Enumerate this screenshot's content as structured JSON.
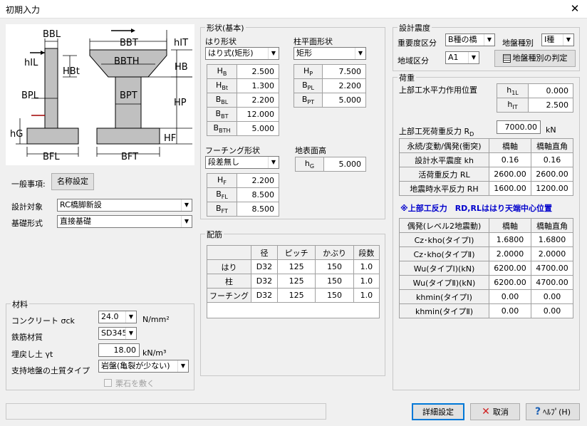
{
  "window": {
    "title": "初期入力",
    "close": "✕"
  },
  "diagram": {
    "labels": {
      "bbl": "BBL",
      "bbt": "BBT",
      "hit": "hIT",
      "hil": "hIL",
      "hbt": "HBt",
      "bbth": "BBTH",
      "hb": "HB",
      "hp": "HP",
      "bpl": "BPL",
      "bpt": "BPT",
      "hg": "hG",
      "hf": "HF",
      "bfl": "BFL",
      "bft": "BFT"
    }
  },
  "general": {
    "label": "一般事項:",
    "name_button": "名称設定"
  },
  "design_target": {
    "label": "設計対象",
    "value": "RC橋脚新設"
  },
  "foundation": {
    "label": "基礎形式",
    "value": "直接基礎"
  },
  "material": {
    "title": "材料",
    "concrete_label": "コンクリート σck",
    "concrete_value": "24.0",
    "concrete_unit": "N/mm²",
    "rebar_label": "鉄筋材質",
    "rebar_value": "SD345",
    "backfill_label": "埋戻し土 γt",
    "backfill_value": "18.00",
    "backfill_unit": "kN/m³",
    "soil_label": "支持地盤の土質タイプ",
    "soil_value": "岩盤(亀裂が少ない)",
    "gravel_label": "栗石を敷く"
  },
  "shape": {
    "title": "形状(基本)",
    "beam_label": "はり形状",
    "beam_value": "はり式(矩形)",
    "beam_rows": [
      {
        "name": "H",
        "sub": "B",
        "value": "2.500"
      },
      {
        "name": "H",
        "sub": "Bt",
        "value": "1.300"
      },
      {
        "name": "B",
        "sub": "BL",
        "value": "2.200"
      },
      {
        "name": "B",
        "sub": "BT",
        "value": "12.000"
      },
      {
        "name": "B",
        "sub": "BTH",
        "value": "5.000"
      }
    ],
    "column_label": "柱平面形状",
    "column_value": "矩形",
    "column_rows": [
      {
        "name": "H",
        "sub": "P",
        "value": "7.500"
      },
      {
        "name": "B",
        "sub": "PL",
        "value": "2.200"
      },
      {
        "name": "B",
        "sub": "PT",
        "value": "5.000"
      }
    ],
    "footing_label": "フーチング形状",
    "footing_value": "段差無し",
    "footing_rows": [
      {
        "name": "H",
        "sub": "F",
        "value": "2.200"
      },
      {
        "name": "B",
        "sub": "FL",
        "value": "8.500"
      },
      {
        "name": "B",
        "sub": "FT",
        "value": "8.500"
      }
    ],
    "ground_label": "地表面高",
    "ground_row": {
      "name": "h",
      "sub": "G",
      "value": "5.000"
    }
  },
  "rebar": {
    "title": "配筋",
    "headers": [
      "",
      "径",
      "ピッチ",
      "かぶり",
      "段数"
    ],
    "rows": [
      [
        "はり",
        "D32",
        "125",
        "150",
        "1.0"
      ],
      [
        "柱",
        "D32",
        "125",
        "150",
        "1.0"
      ],
      [
        "フーチング",
        "D32",
        "125",
        "150",
        "1.0"
      ]
    ]
  },
  "seismic": {
    "title": "設計震度",
    "importance_label": "重要度区分",
    "importance_value": "B種の橋",
    "ground_type_label": "地盤種別",
    "ground_type_value": "I種",
    "region_label": "地域区分",
    "region_value": "A1",
    "judge_button": "地盤種別の判定"
  },
  "load": {
    "title": "荷重",
    "hpos_label": "上部工水平力作用位置",
    "hpos_rows": [
      {
        "name": "h",
        "sub": "1L",
        "value": "0.000"
      },
      {
        "name": "h",
        "sub": "IT",
        "value": "2.500"
      }
    ],
    "rd_label": "上部工死荷重反力 R",
    "rd_sub": "D",
    "rd_value": "7000.00",
    "rd_unit": "kN",
    "perm_headers": [
      "永続/変動/偶発(衝突)",
      "橋軸",
      "橋軸直角"
    ],
    "perm_rows": [
      [
        "設計水平震度 kh",
        "0.16",
        "0.16"
      ],
      [
        "活荷重反力 RL",
        "2600.00",
        "2600.00"
      ],
      [
        "地震時水平反力 RH",
        "1600.00",
        "1200.00"
      ]
    ],
    "note": "※上部工反力　RD,RLははり天端中心位置",
    "acc_headers": [
      "偶発(レベル2地震動)",
      "橋軸",
      "橋軸直角"
    ],
    "acc_rows": [
      [
        "Cz･kho(タイプⅠ)",
        "1.6800",
        "1.6800"
      ],
      [
        "Cz･kho(タイプⅡ)",
        "2.0000",
        "2.0000"
      ],
      [
        "Wu(タイプⅠ)(kN)",
        "6200.00",
        "4700.00"
      ],
      [
        "Wu(タイプⅡ)(kN)",
        "6200.00",
        "4700.00"
      ],
      [
        "khmin(タイプⅠ)",
        "0.00",
        "0.00"
      ],
      [
        "khmin(タイプⅡ)",
        "0.00",
        "0.00"
      ]
    ]
  },
  "footer": {
    "detail_button": "詳細設定",
    "cancel_button": "取消",
    "help_button": "ﾍﾙﾌﾟ(H)"
  },
  "colors": {
    "concrete": "#c0c0c0",
    "cancel_x": "#d02020",
    "note": "#0000cc",
    "help_q": "#1a5fb4"
  }
}
